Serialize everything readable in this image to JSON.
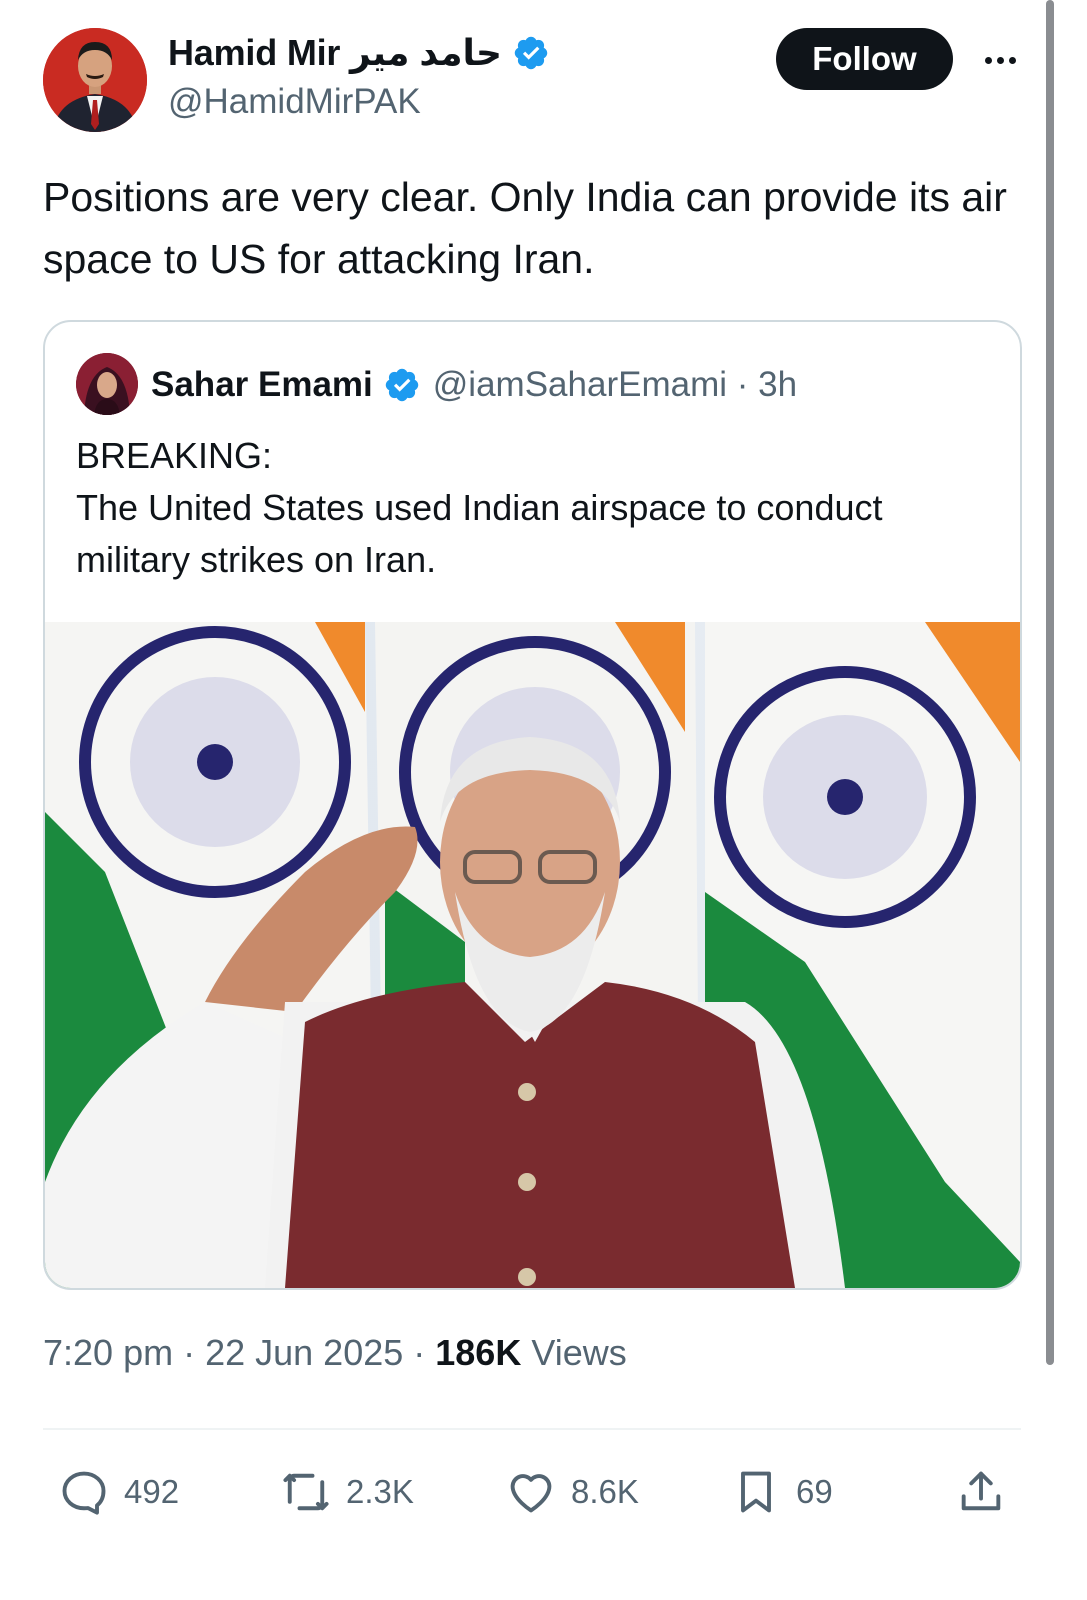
{
  "author": {
    "name": "Hamid Mir حامد میر",
    "handle": "@HamidMirPAK",
    "verified_icon": "verified-badge-icon"
  },
  "follow_label": "Follow",
  "more_icon": "more-dots-icon",
  "tweet_text": "Positions are very clear. Only India can provide its air space to US for attacking Iran.",
  "quoted": {
    "name": "Sahar Emami",
    "handle": "@iamSaharEmami",
    "time": "· 3h",
    "text_line1": "BREAKING:",
    "text_line2": "The United States used Indian airspace to conduct military strikes on Iran."
  },
  "meta": {
    "time": "7:20 pm",
    "sep1": " · ",
    "date": "22 Jun 2025",
    "sep2": " · ",
    "views_count": "186K",
    "views_label": " Views"
  },
  "actions": {
    "replies": "492",
    "reposts": "2.3K",
    "likes": "8.6K",
    "bookmarks": "69"
  },
  "colors": {
    "text": "#0f1419",
    "secondary": "#536471",
    "verified": "#1d9bf0",
    "border": "#cfd9de"
  }
}
